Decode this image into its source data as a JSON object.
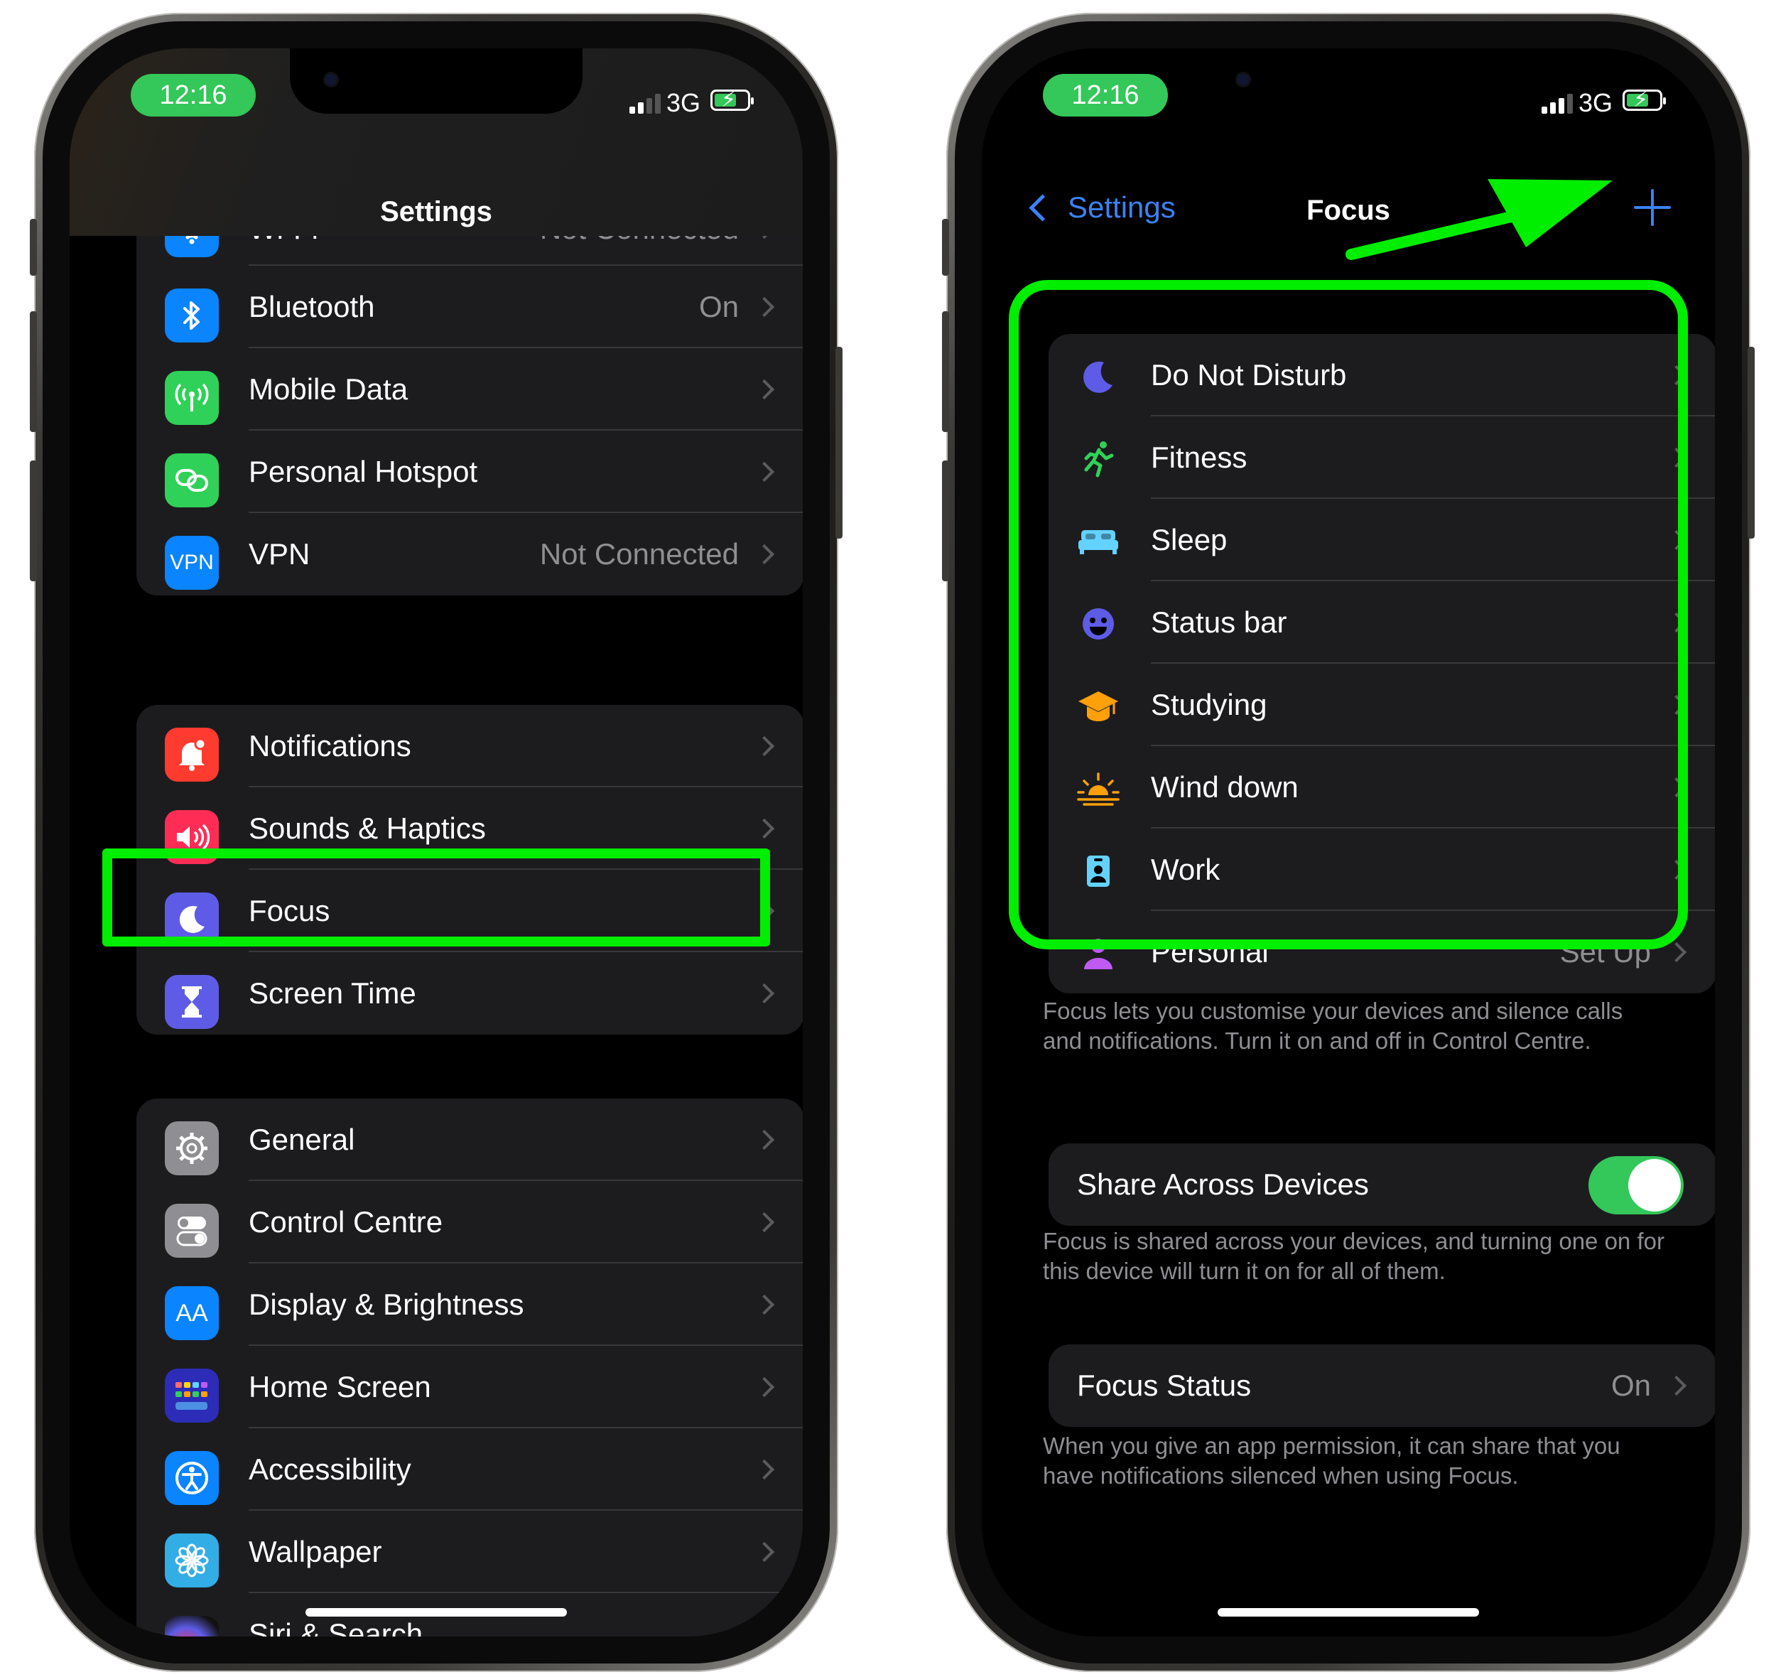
{
  "left": {
    "status": {
      "time": "12:16",
      "network": "3G"
    },
    "title": "Settings",
    "group1": [
      {
        "label": "Wi-Fi",
        "value": "Not Connected",
        "icon": "wifi-icon",
        "color": "#0a84ff"
      },
      {
        "label": "Bluetooth",
        "value": "On",
        "icon": "bluetooth-icon",
        "color": "#0a84ff"
      },
      {
        "label": "Mobile Data",
        "value": "",
        "icon": "antenna-icon",
        "color": "#30d158"
      },
      {
        "label": "Personal Hotspot",
        "value": "",
        "icon": "hotspot-link-icon",
        "color": "#30d158"
      },
      {
        "label": "VPN",
        "value": "Not Connected",
        "icon": "vpn-icon",
        "color": "#0a84ff",
        "icon_text": "VPN"
      }
    ],
    "group2": [
      {
        "label": "Notifications",
        "value": "",
        "icon": "bell-icon",
        "color": "#ff3b30"
      },
      {
        "label": "Sounds & Haptics",
        "value": "",
        "icon": "speaker-icon",
        "color": "#ff2d55"
      },
      {
        "label": "Focus",
        "value": "",
        "icon": "moon-icon",
        "color": "#5e5ce6"
      },
      {
        "label": "Screen Time",
        "value": "",
        "icon": "hourglass-icon",
        "color": "#5e5ce6"
      }
    ],
    "group3": [
      {
        "label": "General",
        "value": "",
        "icon": "gear-icon",
        "color": "#8e8e93"
      },
      {
        "label": "Control Centre",
        "value": "",
        "icon": "toggles-icon",
        "color": "#8e8e93"
      },
      {
        "label": "Display & Brightness",
        "value": "",
        "icon": "text-size-icon",
        "color": "#0a84ff",
        "icon_text": "AA"
      },
      {
        "label": "Home Screen",
        "value": "",
        "icon": "app-grid-icon",
        "color": "#2c2cb8"
      },
      {
        "label": "Accessibility",
        "value": "",
        "icon": "accessibility-icon",
        "color": "#0a84ff"
      },
      {
        "label": "Wallpaper",
        "value": "",
        "icon": "flower-icon",
        "color": "#32ade6"
      },
      {
        "label": "Siri & Search",
        "value": "",
        "icon": "siri-icon",
        "color": "#222"
      }
    ]
  },
  "right": {
    "status": {
      "time": "12:16",
      "network": "3G"
    },
    "back_label": "Settings",
    "title": "Focus",
    "modes": [
      {
        "label": "Do Not Disturb",
        "value": "",
        "icon": "moon-icon",
        "color": "#5e5ce6"
      },
      {
        "label": "Fitness",
        "value": "",
        "icon": "running-icon",
        "color": "#30d158"
      },
      {
        "label": "Sleep",
        "value": "",
        "icon": "bed-icon",
        "color": "#64d2ff"
      },
      {
        "label": "Status bar",
        "value": "",
        "icon": "smiley-icon",
        "color": "#5e5ce6"
      },
      {
        "label": "Studying",
        "value": "",
        "icon": "graduation-cap-icon",
        "color": "#ff9f0a"
      },
      {
        "label": "Wind down",
        "value": "",
        "icon": "sunset-icon",
        "color": "#ff9f0a"
      },
      {
        "label": "Work",
        "value": "",
        "icon": "id-badge-icon",
        "color": "#64d2ff"
      },
      {
        "label": "Personal",
        "value": "Set Up",
        "icon": "person-icon",
        "color": "#bf5af2"
      }
    ],
    "modes_footer": "Focus lets you customise your devices and silence calls and notifications. Turn it on and off in Control Centre.",
    "share": {
      "label": "Share Across Devices",
      "on": true
    },
    "share_footer": "Focus is shared across your devices, and turning one on for this device will turn it on for all of them.",
    "status_row": {
      "label": "Focus Status",
      "value": "On"
    },
    "status_footer": "When you give an app permission, it can share that you have notifications silenced when using Focus."
  },
  "highlight_color": "#00ee00"
}
